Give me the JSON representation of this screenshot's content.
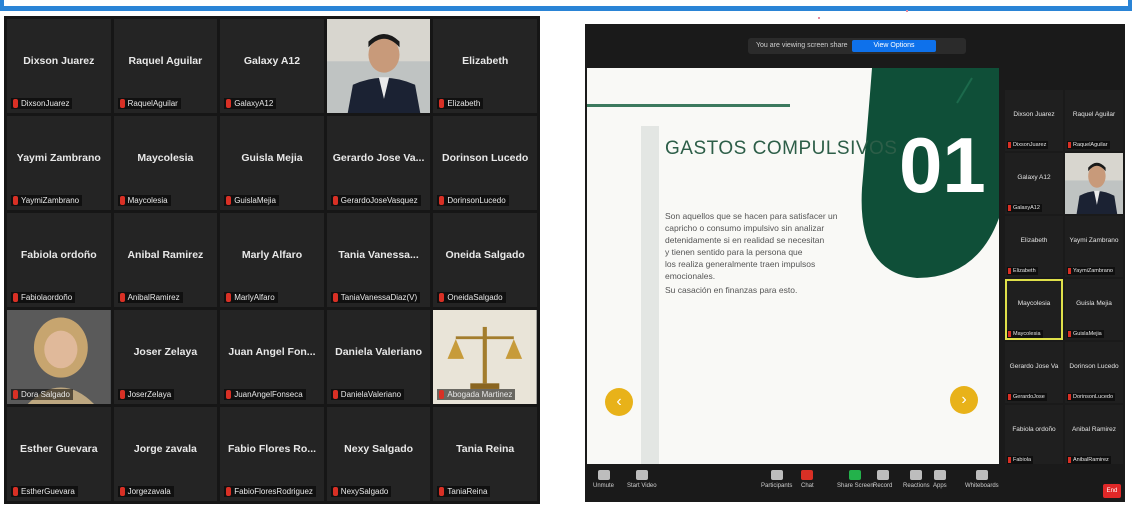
{
  "left_gallery": {
    "tiles": [
      {
        "name": "Dixson Juarez",
        "label": "DixsonJuarez",
        "video": false
      },
      {
        "name": "Raquel Aguilar",
        "label": "RaquelAguilar",
        "video": false
      },
      {
        "name": "Galaxy A12",
        "label": "GalaxyA12",
        "video": false
      },
      {
        "name": "",
        "label": "",
        "video": true,
        "highlight": true
      },
      {
        "name": "Elizabeth",
        "label": "Elizabeth",
        "video": false
      },
      {
        "name": "Yaymi Zambrano",
        "label": "YaymiZambrano",
        "video": false
      },
      {
        "name": "Maycolesia",
        "label": "Maycolesia",
        "video": false
      },
      {
        "name": "Guisla Mejia",
        "label": "GuislaMejia",
        "video": false
      },
      {
        "name": "Gerardo Jose Va...",
        "label": "GerardoJoseVasquez",
        "video": false
      },
      {
        "name": "Dorinson Lucedo",
        "label": "DorinsonLucedo",
        "video": false
      },
      {
        "name": "Fabiola ordoño",
        "label": "Fabiolaordoño",
        "video": false
      },
      {
        "name": "Anibal Ramirez",
        "label": "AnibalRamirez",
        "video": false
      },
      {
        "name": "Marly Alfaro",
        "label": "MarlyAlfaro",
        "video": false
      },
      {
        "name": "Tania Vanessa...",
        "label": "TaniaVanessaDiaz(V)",
        "video": false
      },
      {
        "name": "Oneida Salgado",
        "label": "OneidaSalgado",
        "video": false
      },
      {
        "name": "",
        "label": "Dora Salgado",
        "video": true,
        "highlight": false
      },
      {
        "name": "Joser Zelaya",
        "label": "JoserZelaya",
        "video": false
      },
      {
        "name": "Juan Angel Fon...",
        "label": "JuanAngelFonseca",
        "video": false
      },
      {
        "name": "Daniela Valeriano",
        "label": "DanielaValeriano",
        "video": false
      },
      {
        "name": "",
        "label": "Abogada Martinez",
        "video": true,
        "highlight": false
      },
      {
        "name": "Esther Guevara",
        "label": "EstherGuevara",
        "video": false
      },
      {
        "name": "Jorge zavala",
        "label": "Jorgezavala",
        "video": false
      },
      {
        "name": "Fabio Flores Ro...",
        "label": "FabioFloresRodriguez",
        "video": false
      },
      {
        "name": "Nexy Salgado",
        "label": "NexySalgado",
        "video": false
      },
      {
        "name": "Tania Reina",
        "label": "TaniaReina",
        "video": false
      }
    ]
  },
  "right_window": {
    "share_bar_text": "You are viewing screen share",
    "share_pill_text": "View Options",
    "slide": {
      "title": "GASTOS COMPULSIVOS",
      "number": "01",
      "body_lines": [
        "Son aquellos que se hacen para satisfacer un",
        "capricho o consumo impulsivo sin analizar",
        "detenidamente si en realidad se necesitan",
        "y tienen sentido para la persona que",
        "los realiza generalmente traen impulsos",
        "emocionales.",
        "Su casación en finanzas para esto."
      ],
      "left_arrow": "‹",
      "right_arrow": "›"
    },
    "side_tiles": [
      {
        "name": "Dixson Juarez",
        "label": "DixsonJuarez",
        "highlight": false,
        "video": false
      },
      {
        "name": "Raquel Aguilar",
        "label": "RaquelAguilar",
        "highlight": false,
        "video": false
      },
      {
        "name": "Galaxy A12",
        "label": "GalaxyA12",
        "highlight": false,
        "video": false
      },
      {
        "name": "",
        "label": "",
        "highlight": false,
        "video": true
      },
      {
        "name": "Elizabeth",
        "label": "Elizabeth",
        "highlight": false,
        "video": false
      },
      {
        "name": "Yaymi Zambrano",
        "label": "YaymiZambrano",
        "highlight": false,
        "video": false
      },
      {
        "name": "Maycolesia",
        "label": "Maycolesia",
        "highlight": true,
        "video": false
      },
      {
        "name": "Guisla Mejia",
        "label": "GuislaMejia",
        "highlight": false,
        "video": false
      },
      {
        "name": "Gerardo Jose Va",
        "label": "GerardoJose",
        "highlight": false,
        "video": false
      },
      {
        "name": "Dorinson Lucedo",
        "label": "DorinsonLucedo",
        "highlight": false,
        "video": false
      },
      {
        "name": "Fabiola ordoño",
        "label": "Fabiola",
        "highlight": false,
        "video": false
      },
      {
        "name": "Anibal Ramirez",
        "label": "AnibalRamirez",
        "highlight": false,
        "video": false
      }
    ],
    "toolbar": {
      "items": [
        {
          "label": "Unmute",
          "color": "gray"
        },
        {
          "label": "Start Video",
          "color": "gray"
        },
        {
          "label": "Participants",
          "color": "gray"
        },
        {
          "label": "Chat",
          "color": "red"
        },
        {
          "label": "Share Screen",
          "color": "green"
        },
        {
          "label": "Record",
          "color": "gray"
        },
        {
          "label": "Reactions",
          "color": "gray"
        },
        {
          "label": "Apps",
          "color": "gray"
        },
        {
          "label": "Whiteboards",
          "color": "gray"
        }
      ],
      "end_label": "End"
    }
  }
}
